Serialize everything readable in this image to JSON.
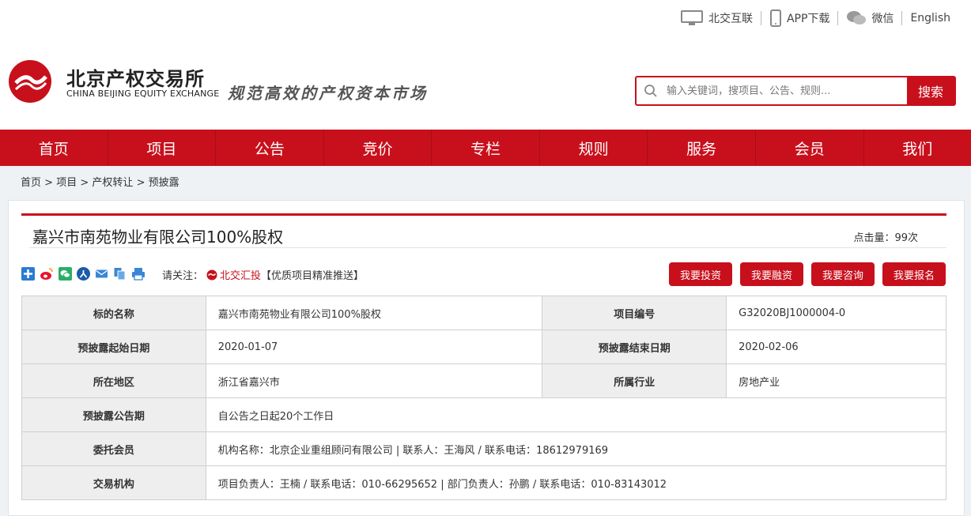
{
  "toplinks": [
    {
      "label": "北交互联",
      "icon": "monitor-icon"
    },
    {
      "label": "APP下载",
      "icon": "phone-icon"
    },
    {
      "label": "微信",
      "icon": "wechat-icon"
    },
    {
      "label": "English",
      "icon": ""
    }
  ],
  "header": {
    "brand_cn": "北京产权交易所",
    "brand_en": "CHINA BEIJING EQUITY EXCHANGE",
    "slogan": "规范高效的产权资本市场"
  },
  "search": {
    "placeholder": "输入关键词，搜项目、公告、规则...",
    "button": "搜索"
  },
  "nav": [
    "首页",
    "项目",
    "公告",
    "竞价",
    "专栏",
    "规则",
    "服务",
    "会员",
    "我们"
  ],
  "breadcrumb": [
    "首页",
    ">",
    "项目",
    ">",
    "产权转让",
    ">",
    "预披露"
  ],
  "project": {
    "title": "嘉兴市南苑物业有限公司100%股权",
    "hits": "点击量：99次"
  },
  "follow": {
    "prefix": "请关注：",
    "link": "北交汇投",
    "suffix": "【优质项目精准推送】"
  },
  "actions": [
    "我要投资",
    "我要融资",
    "我要咨询",
    "我要报名"
  ],
  "info": {
    "row1": {
      "l1": "标的名称",
      "v1": "嘉兴市南苑物业有限公司100%股权",
      "l2": "项目编号",
      "v2": "G32020BJ1000004-0"
    },
    "row2": {
      "l1": "预披露起始日期",
      "v1": "2020-01-07",
      "l2": "预披露结束日期",
      "v2": "2020-02-06"
    },
    "row3": {
      "l1": "所在地区",
      "v1": "浙江省嘉兴市",
      "l2": "所属行业",
      "v2": "房地产业"
    },
    "row4": {
      "l1": "预披露公告期",
      "v1": "自公告之日起20个工作日"
    },
    "row5": {
      "l1": "委托会员",
      "v1": "机构名称：北京企业重组顾问有限公司 | 联系人：王海风 / 联系电话：18612979169"
    },
    "row6": {
      "l1": "交易机构",
      "v1": "项目负责人：王楠 / 联系电话：010-66295652 | 部门负责人：孙鹏 / 联系电话：010-83143012"
    }
  },
  "colors": {
    "brand": "#c8101c",
    "label_bg": "#eeeeee",
    "page_bg": "#eef2f5"
  }
}
